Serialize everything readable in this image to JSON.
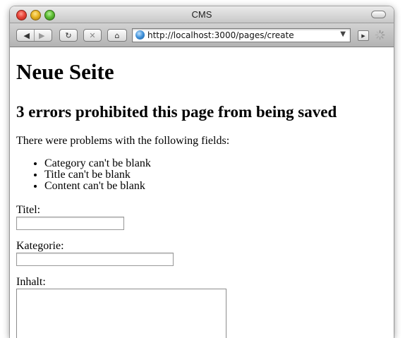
{
  "window": {
    "title": "CMS"
  },
  "toolbar": {
    "back_icon": "back-arrow-icon",
    "forward_icon": "forward-arrow-icon",
    "reload_icon": "reload-icon",
    "stop_icon": "stop-icon",
    "home_icon": "home-icon",
    "url": "http://localhost:3000/pages/create"
  },
  "page": {
    "heading": "Neue Seite",
    "error_heading": "3 errors prohibited this page from being saved",
    "intro": "There were problems with the following fields:",
    "errors": [
      "Category can't be blank",
      "Title can't be blank",
      "Content can't be blank"
    ],
    "fields": {
      "title_label": "Titel:",
      "title_value": "",
      "category_label": "Kategorie:",
      "category_value": "",
      "content_label": "Inhalt:",
      "content_value": ""
    }
  },
  "colors": {
    "titlebar": "#d6d6d6",
    "toolbar": "#c0c0c0",
    "page_background": "#ffffff"
  }
}
